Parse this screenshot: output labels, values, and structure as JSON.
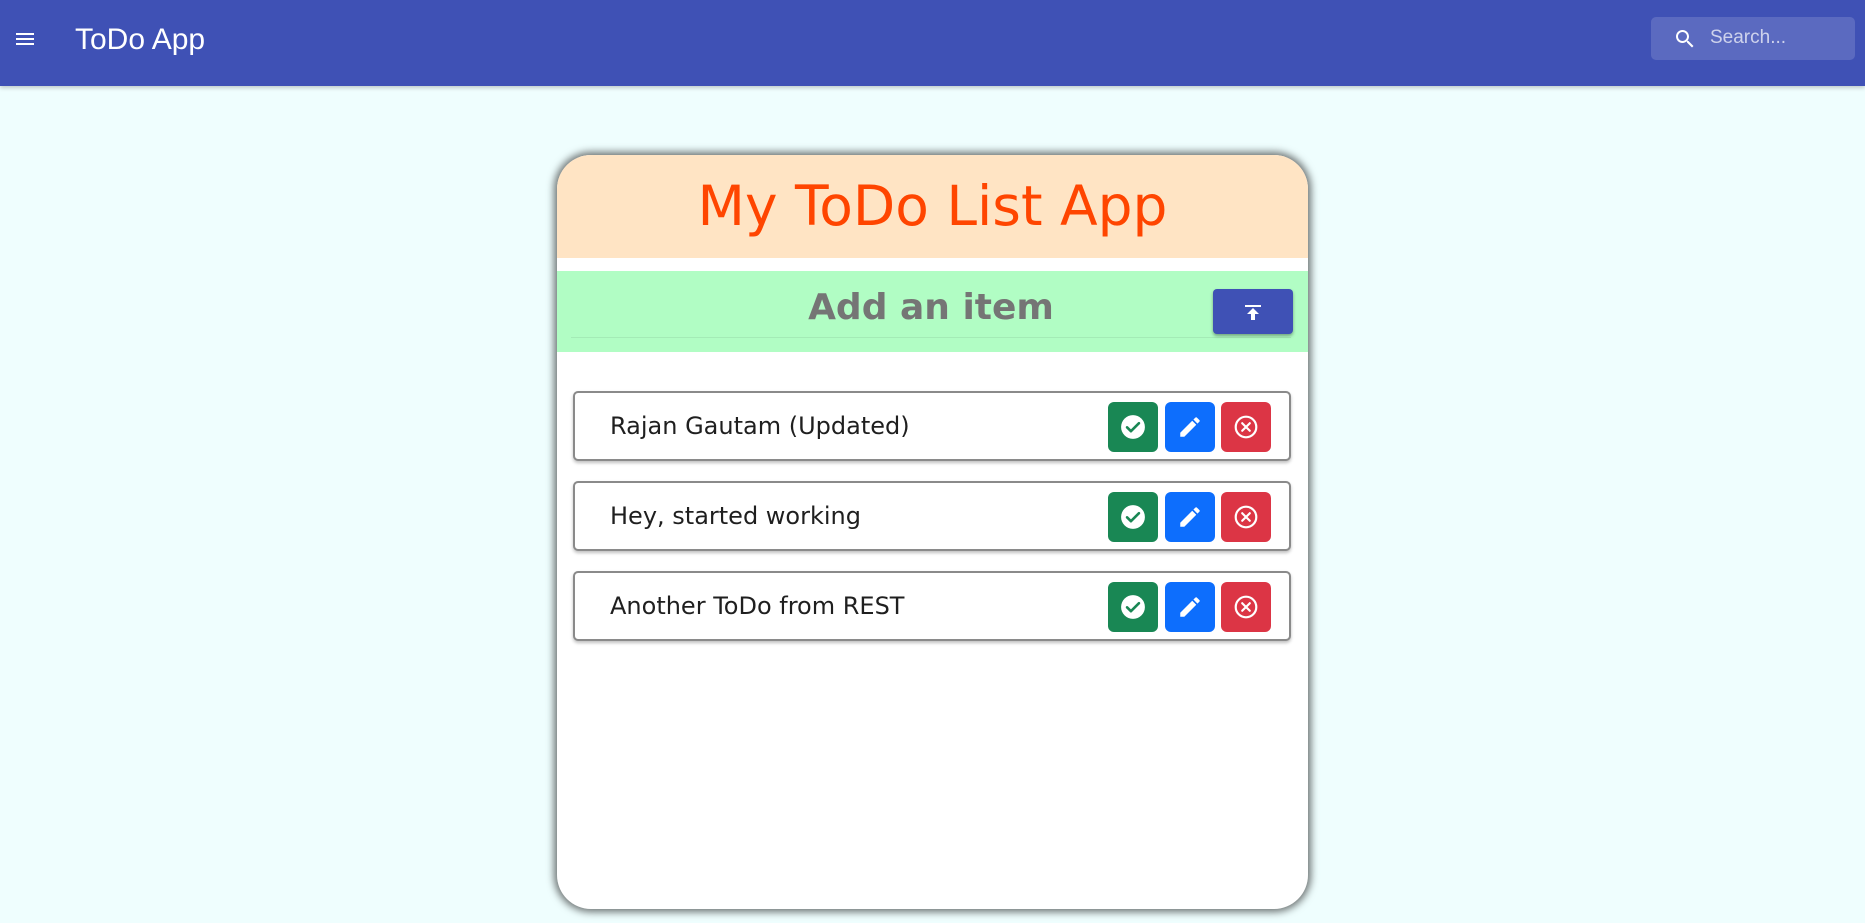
{
  "appbar": {
    "title": "ToDo App",
    "menu_icon": "menu-icon",
    "search": {
      "placeholder": "Search...",
      "value": "",
      "icon": "search-icon"
    },
    "color": "#3f51b5"
  },
  "card": {
    "title": "My ToDo List App",
    "title_color": "#ff4500",
    "header_bg": "#ffe4c4",
    "add_bar_bg": "#b1fdc4",
    "add_input": {
      "placeholder": "Add an item",
      "value": ""
    },
    "add_button_icon": "upload-icon"
  },
  "todos": [
    {
      "text": "Rajan Gautam (Updated)"
    },
    {
      "text": "Hey, started working"
    },
    {
      "text": "Another ToDo from REST"
    }
  ],
  "item_actions": {
    "done": {
      "icon": "check-circle-icon",
      "color": "#198754"
    },
    "edit": {
      "icon": "pencil-icon",
      "color": "#0d6efd"
    },
    "delete": {
      "icon": "close-circle-icon",
      "color": "#dc3545"
    }
  }
}
